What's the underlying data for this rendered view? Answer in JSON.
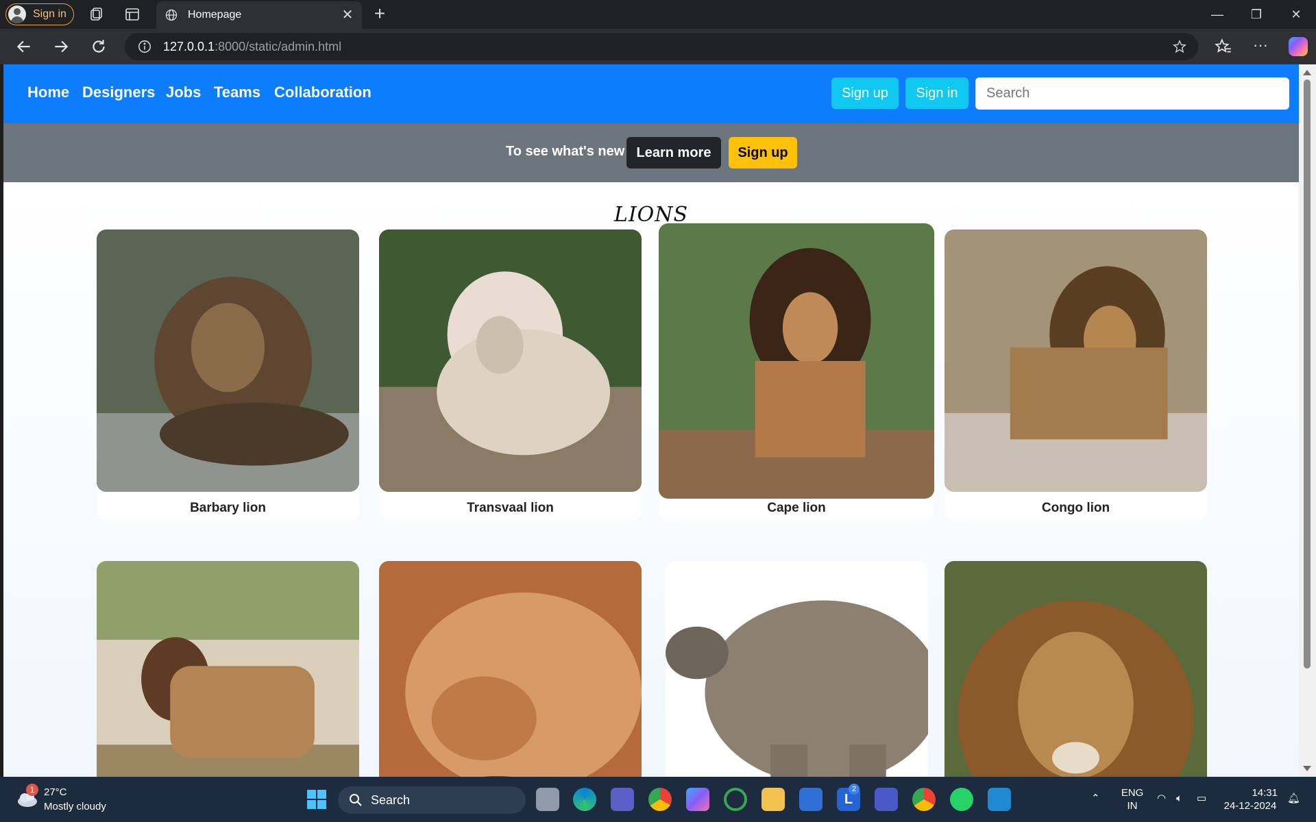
{
  "browser": {
    "profile_label": "Sign in",
    "tab_title": "Homepage",
    "url_host": "127.0.0.1",
    "url_rest": ":8000/static/admin.html"
  },
  "navbar": {
    "links": [
      "Home",
      "Designers",
      "Jobs",
      "Teams",
      "Collaboration"
    ],
    "signup_label": "Sign up",
    "signin_label": "Sign in",
    "search_placeholder": "Search",
    "color": "#0d7dfb",
    "button_color": "#10c8f0"
  },
  "banner": {
    "text": "To see what's new",
    "learn_more_label": "Learn more",
    "signup_label": "Sign up"
  },
  "gallery": {
    "title": "LIONS",
    "cards": [
      {
        "caption": "Barbary lion"
      },
      {
        "caption": "Transvaal lion"
      },
      {
        "caption": "Cape lion"
      },
      {
        "caption": "Congo lion"
      },
      {
        "caption": ""
      },
      {
        "caption": ""
      },
      {
        "caption": ""
      },
      {
        "caption": ""
      }
    ]
  },
  "taskbar": {
    "weather_badge": "1",
    "weather_temp": "27°C",
    "weather_desc": "Mostly cloudy",
    "search_label": "Search",
    "lang_line1": "ENG",
    "lang_line2": "IN",
    "time": "14:31",
    "date": "24-12-2024",
    "teams_badge": "2"
  }
}
